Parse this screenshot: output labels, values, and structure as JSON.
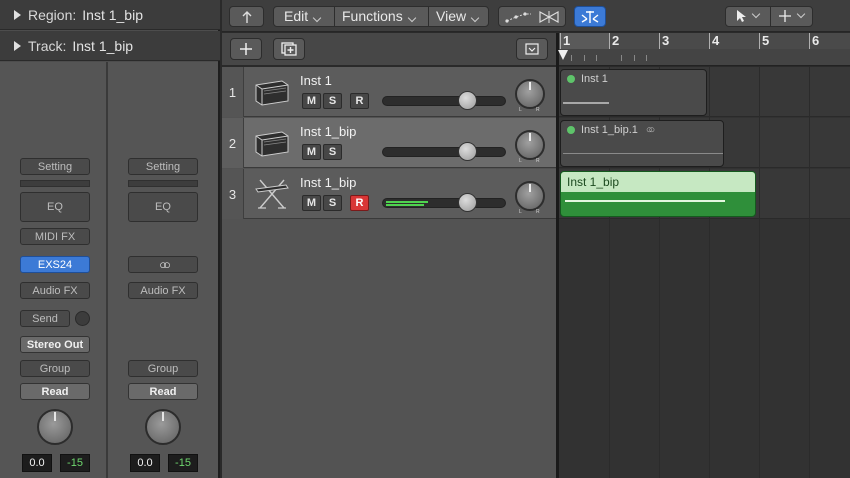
{
  "inspector": {
    "region_label": "Region:",
    "region_name": "Inst 1_bip",
    "track_label": "Track:",
    "track_name": "Inst 1_bip",
    "strip1": {
      "setting": "Setting",
      "eq": "EQ",
      "midi_fx": "MIDI FX",
      "instrument": "EXS24",
      "audio_fx": "Audio FX",
      "send": "Send",
      "output": "Stereo Out",
      "group": "Group",
      "automation": "Read",
      "volume": "0.0",
      "peak": "-15"
    },
    "strip2": {
      "setting": "Setting",
      "eq": "EQ",
      "audio_fx": "Audio FX",
      "group": "Group",
      "automation": "Read",
      "volume": "0.0",
      "peak": "-15"
    }
  },
  "toolbar": {
    "edit": "Edit",
    "functions": "Functions",
    "view": "View"
  },
  "tracks": [
    {
      "number": "1",
      "name": "Inst 1",
      "mute": "M",
      "solo": "S",
      "record": "R",
      "armed": false,
      "icon": "piano-icon"
    },
    {
      "number": "2",
      "name": "Inst 1_bip",
      "mute": "M",
      "solo": "S",
      "record": "",
      "armed": false,
      "icon": "piano-icon"
    },
    {
      "number": "3",
      "name": "Inst 1_bip",
      "mute": "M",
      "solo": "S",
      "record": "R",
      "armed": true,
      "icon": "keyboard-stand-icon"
    }
  ],
  "ruler": {
    "bars": [
      "1",
      "2",
      "3",
      "4",
      "5",
      "6"
    ]
  },
  "regions": [
    {
      "name": "Inst 1"
    },
    {
      "name": "Inst 1_bip.1"
    },
    {
      "name": "Inst 1_bip"
    }
  ],
  "colors": {
    "accent_blue": "#3c7ad6",
    "record_red": "#d93636",
    "region_green": "#2f8f3a",
    "meter_green": "#4fd34f"
  }
}
